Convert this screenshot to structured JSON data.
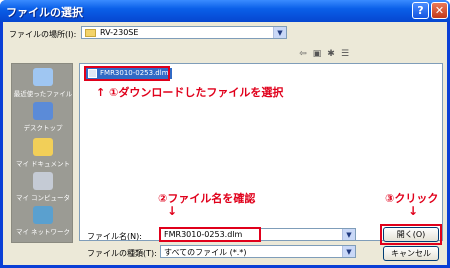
{
  "dialog": {
    "title": "ファイルの選択"
  },
  "lookin": {
    "label": "ファイルの場所(I):",
    "value": "RV-230SE"
  },
  "places": [
    {
      "label": "最近使ったファイル",
      "icon": "recent-documents-icon"
    },
    {
      "label": "デスクトップ",
      "icon": "desktop-icon"
    },
    {
      "label": "マイ ドキュメント",
      "icon": "my-documents-icon"
    },
    {
      "label": "マイ コンピュータ",
      "icon": "my-computer-icon"
    },
    {
      "label": "マイ ネットワーク",
      "icon": "my-network-icon"
    }
  ],
  "files": [
    {
      "name": "FMR3010-0253.dlm"
    }
  ],
  "filename": {
    "label": "ファイル名(N):",
    "value": "FMR3010-0253.dlm"
  },
  "filetype": {
    "label": "ファイルの種類(T):",
    "value": "すべてのファイル (*.*)"
  },
  "buttons": {
    "open": "開く(O)",
    "cancel": "キャンセル"
  },
  "annotations": {
    "step1": "↑ ①ダウンロードしたファイルを選択",
    "step2": "②ファイル名を確認",
    "step3": "③クリック"
  },
  "colors": {
    "annotation": "#e0001b",
    "selection": "#316ac5",
    "titlebar": "#0a5fe8"
  }
}
